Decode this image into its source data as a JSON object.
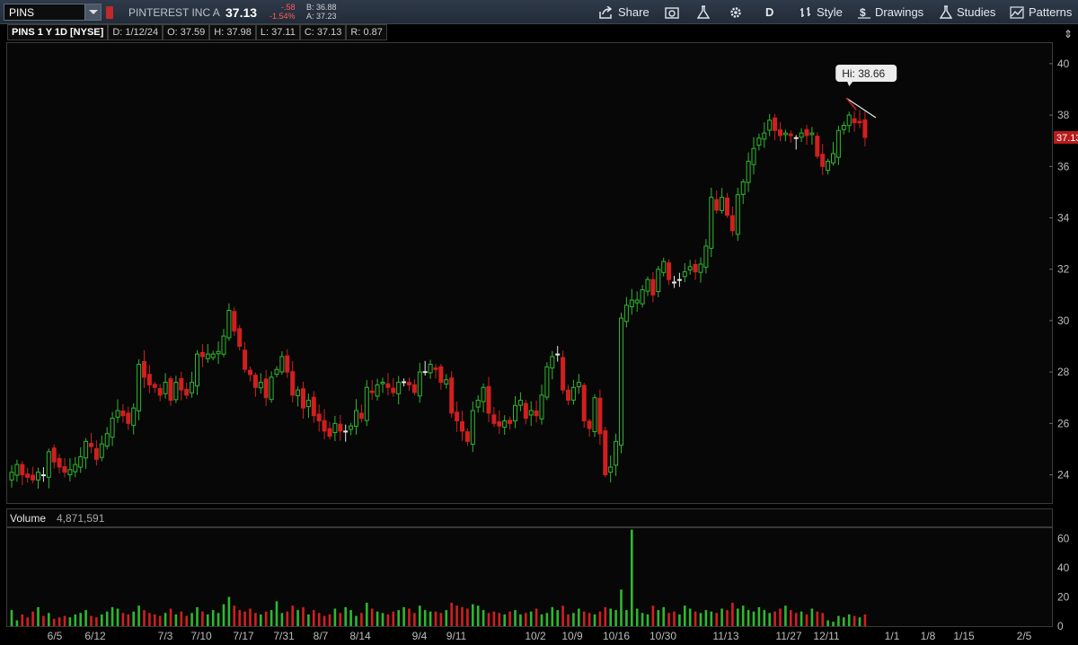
{
  "toolbar": {
    "symbol": "PINS",
    "company": "PINTEREST INC A",
    "last": "37.13",
    "change": "-.58",
    "change_pct": "-1.54%",
    "bid": "B: 36.88",
    "ask": "A: 37.23",
    "share_label": "Share",
    "aggregation": "D",
    "style_label": "Style",
    "drawings_label": "Drawings",
    "studies_label": "Studies",
    "patterns_label": "Patterns"
  },
  "info": {
    "title": "PINS 1 Y 1D [NYSE]",
    "date": "D: 1/12/24",
    "open": "O: 37.59",
    "high": "H: 37.98",
    "low": "L: 37.11",
    "close": "C: 37.13",
    "range": "R: 0.87"
  },
  "volume_label": "Volume",
  "volume_value": "4,871,591",
  "colors": {
    "up": "#2eb82e",
    "down": "#d11f1f",
    "neutral": "#e6e6e6",
    "tag": "#b81c1c"
  },
  "chart_data": {
    "type": "candlestick",
    "symbol": "PINS",
    "price_axis": {
      "ticks": [
        24,
        26,
        28,
        30,
        32,
        34,
        36,
        38,
        40
      ],
      "ylim": [
        22.9,
        40.8
      ]
    },
    "volume_axis": {
      "ticks": [
        0,
        20,
        40,
        60
      ],
      "ylim": [
        0,
        67
      ]
    },
    "x_ticks": [
      "6/5",
      "6/12",
      "7/3",
      "7/10",
      "7/17",
      "7/31",
      "8/7",
      "8/14",
      "9/4",
      "9/11",
      "10/2",
      "10/9",
      "10/16",
      "10/30",
      "11/13",
      "11/27",
      "12/11",
      "1/1",
      "1/8",
      "1/15",
      "2/5"
    ],
    "last_price_tag": "37.13",
    "high_callout": "Hi: 38.66",
    "series": [
      {
        "name": "price",
        "note": "daily candles, closes traced from chart",
        "closes": [
          24.1,
          24.4,
          24.0,
          23.9,
          23.8,
          24.1,
          24.0,
          24.9,
          24.5,
          24.3,
          24.1,
          24.2,
          24.4,
          24.7,
          25.3,
          25.1,
          24.6,
          25.2,
          25.6,
          26.2,
          26.5,
          26.3,
          26.0,
          26.6,
          28.3,
          27.8,
          27.5,
          27.4,
          27.1,
          27.6,
          26.9,
          27.6,
          27.3,
          27.1,
          27.6,
          28.7,
          28.6,
          28.7,
          28.7,
          28.8,
          29.4,
          30.4,
          29.6,
          29.0,
          28.1,
          27.9,
          27.4,
          27.6,
          27.0,
          27.8,
          28.1,
          28.6,
          28.0,
          27.1,
          27.3,
          26.6,
          26.9,
          26.3,
          26.1,
          25.7,
          25.5,
          26.0,
          25.7,
          25.7,
          25.9,
          26.5,
          26.2,
          27.4,
          27.2,
          27.5,
          27.6,
          27.4,
          27.2,
          27.6,
          27.6,
          27.5,
          27.2,
          28.0,
          28.0,
          28.3,
          28.1,
          27.6,
          27.7,
          26.4,
          26.1,
          25.7,
          25.3,
          26.5,
          26.9,
          27.4,
          26.4,
          26.0,
          25.9,
          26.1,
          26.0,
          26.7,
          26.9,
          26.2,
          26.5,
          26.3,
          27.1,
          28.2,
          28.6,
          28.7,
          27.3,
          26.9,
          27.4,
          27.6,
          26.1,
          25.8,
          27.0,
          25.6,
          24.0,
          24.3,
          25.3,
          30.1,
          30.6,
          30.8,
          30.8,
          31.2,
          31.6,
          31.0,
          32.0,
          32.3,
          31.6,
          31.5,
          31.6,
          31.9,
          32.1,
          31.9,
          32.2,
          32.9,
          34.8,
          34.3,
          34.8,
          34.1,
          33.5,
          34.9,
          35.4,
          36.2,
          36.7,
          37.1,
          37.3,
          37.8,
          37.4,
          37.2,
          37.3,
          37.2,
          37.1,
          37.3,
          37.2,
          37.3,
          36.4,
          36.0,
          36.2,
          36.5,
          37.4,
          37.6,
          38.0,
          37.7,
          37.7,
          37.13
        ]
      },
      {
        "name": "volume",
        "note": "approximate daily volume (millions)",
        "values": [
          11,
          4,
          8,
          6,
          10,
          13,
          7,
          9,
          5,
          6,
          7,
          6,
          8,
          9,
          11,
          7,
          6,
          8,
          10,
          13,
          12,
          9,
          8,
          10,
          14,
          11,
          9,
          8,
          7,
          9,
          12,
          8,
          10,
          7,
          9,
          13,
          10,
          8,
          11,
          9,
          15,
          20,
          14,
          11,
          10,
          12,
          9,
          8,
          10,
          11,
          17,
          9,
          10,
          14,
          11,
          13,
          8,
          11,
          9,
          7,
          8,
          12,
          9,
          13,
          11,
          7,
          9,
          16,
          12,
          10,
          9,
          8,
          10,
          11,
          13,
          12,
          9,
          14,
          11,
          10,
          10,
          9,
          11,
          16,
          14,
          13,
          12,
          15,
          14,
          11,
          9,
          10,
          9,
          8,
          10,
          11,
          8,
          9,
          10,
          12,
          8,
          9,
          13,
          11,
          14,
          8,
          9,
          12,
          10,
          9,
          8,
          10,
          13,
          12,
          11,
          25,
          11,
          66,
          12,
          9,
          8,
          14,
          11,
          13,
          9,
          10,
          8,
          14,
          12,
          10,
          9,
          11,
          10,
          9,
          12,
          11,
          16,
          12,
          14,
          11,
          10,
          13,
          11,
          9,
          10,
          12,
          14,
          11,
          9,
          10,
          8,
          12,
          10,
          9,
          4,
          3,
          7,
          6,
          8,
          7,
          6,
          8,
          9,
          7,
          6,
          5
        ]
      }
    ]
  }
}
